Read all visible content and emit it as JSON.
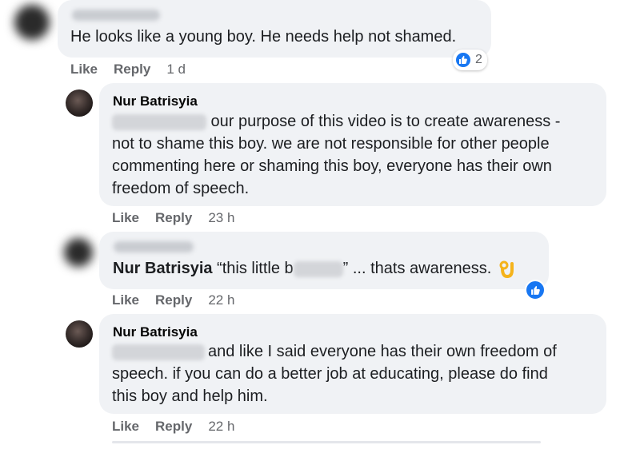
{
  "thread": {
    "comments": [
      {
        "text": "He looks like a young boy. He needs help not shamed.",
        "like_label": "Like",
        "reply_label": "Reply",
        "time": "1 d",
        "reaction_count": "2"
      },
      {
        "author": "Nur Batrisyia",
        "text_line1": " our purpose of this video is to create awareness -",
        "text_line2": "not to shame this boy. we are not responsible for other people",
        "text_line3": "commenting here or shaming this boy, everyone has their own",
        "text_line4": "freedom of speech.",
        "like_label": "Like",
        "reply_label": "Reply",
        "time": "23 h"
      },
      {
        "author": "Nur Batrisyia",
        "text_before": " “this little b",
        "text_after": "” ... thats awareness.",
        "like_label": "Like",
        "reply_label": "Reply",
        "time": "22 h"
      },
      {
        "author": "Nur Batrisyia",
        "text_line1": "and like I said everyone has their own freedom of",
        "text_line2": "speech. if you can do a better job at educating, please do find",
        "text_line3": "this boy and help him.",
        "like_label": "Like",
        "reply_label": "Reply",
        "time": "22 h"
      }
    ]
  },
  "colors": {
    "bubble": "#f0f2f5",
    "like_blue": "#1877f2",
    "meta_gray": "#65676b"
  },
  "icons": [
    "thumbs-up-icon",
    "ok-hand-emoji-icon"
  ]
}
